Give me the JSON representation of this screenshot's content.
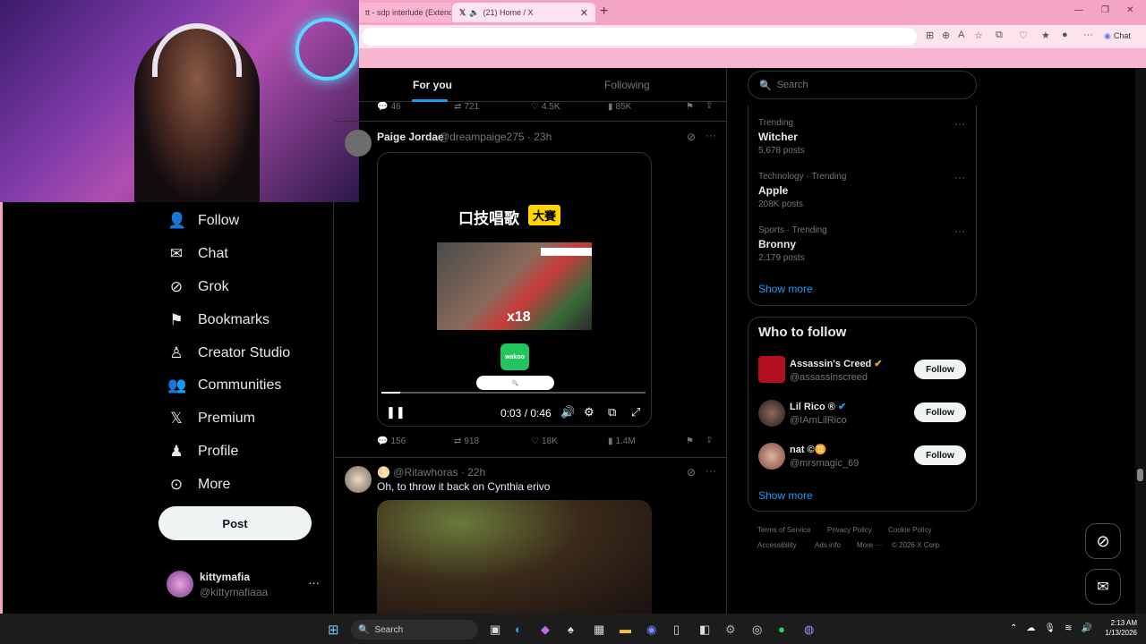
{
  "browser": {
    "tabs": [
      {
        "label": "tt - sdp interlude (Extend"
      },
      {
        "label": "(21) Home / X"
      }
    ],
    "chat_label": "Chat"
  },
  "nav": {
    "items": [
      {
        "icon": "follow-icon",
        "label": "Follow"
      },
      {
        "icon": "chat-icon",
        "label": "Chat"
      },
      {
        "icon": "grok-icon",
        "label": "Grok"
      },
      {
        "icon": "bookmark-icon",
        "label": "Bookmarks"
      },
      {
        "icon": "creator-studio-icon",
        "label": "Creator Studio"
      },
      {
        "icon": "communities-icon",
        "label": "Communities"
      },
      {
        "icon": "x-logo-icon",
        "label": "Premium"
      },
      {
        "icon": "profile-icon",
        "label": "Profile"
      },
      {
        "icon": "more-icon",
        "label": "More"
      }
    ],
    "post_label": "Post",
    "account": {
      "name": "kittymafia",
      "handle": "@kittymafiaaa"
    }
  },
  "timeline": {
    "tabs": {
      "for_you": "For you",
      "following": "Following"
    },
    "top_stats": {
      "replies": "46",
      "reposts": "721",
      "likes": "4.5K",
      "views": "85K"
    },
    "post1": {
      "name": "Paige Jordae",
      "handle": "@dreampaige275 · 23h",
      "video": {
        "title": "口技唱歌",
        "badge": "大賽",
        "count": "x18",
        "logo": "wakoo",
        "time": "0:03 / 0:46",
        "progress": 0.07
      },
      "stats": {
        "replies": "156",
        "reposts": "918",
        "likes": "18K",
        "views": "1.4M"
      }
    },
    "post2": {
      "handle": "@Ritawhoras · 22h",
      "text": "Oh, to throw it back on Cynthia erivo"
    }
  },
  "sidebar": {
    "search_placeholder": "Search",
    "trends": [
      {
        "meta": "Trending",
        "title": "Witcher",
        "count": "5,678 posts"
      },
      {
        "meta": "Technology · Trending",
        "title": "Apple",
        "count": "208K posts"
      },
      {
        "meta": "Sports · Trending",
        "title": "Bronny",
        "count": "2,179 posts"
      }
    ],
    "show_more": "Show more",
    "who_to_follow": {
      "title": "Who to follow",
      "accounts": [
        {
          "name": "Assassin's Creed",
          "handle": "@assassinscreed",
          "follow": "Follow"
        },
        {
          "name": "Lil Rico ®",
          "handle": "@IAmLilRico",
          "follow": "Follow"
        },
        {
          "name": "nat ©♊",
          "handle": "@mrsmagic_69",
          "follow": "Follow"
        }
      ],
      "show_more": "Show more"
    },
    "footer": {
      "links": [
        "Terms of Service",
        "Privacy Policy",
        "Cookie Policy",
        "Accessibility",
        "Ads info",
        "More ···"
      ],
      "copyright": "© 2026 X Corp."
    }
  },
  "taskbar": {
    "search": "Search",
    "time": "2:13 AM",
    "date": "1/13/2026"
  },
  "colors": {
    "accent": "#1d9bf0",
    "browser_pink": "#f4a4c4",
    "background": "#000000"
  }
}
